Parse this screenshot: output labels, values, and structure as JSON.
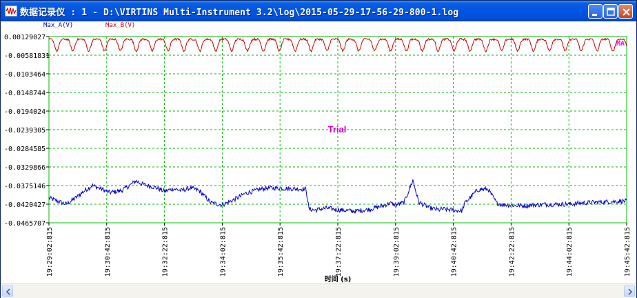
{
  "window": {
    "title": "数据记录仪 : 1 - D:\\VIRTINS Multi-Instrument 3.2\\log\\2015-05-29-17-56-29-800-1.log",
    "icon": "waveform-icon",
    "buttons": [
      "minimize-icon",
      "maximize-icon",
      "close-icon"
    ]
  },
  "colors": {
    "series_a": "#0000cc",
    "series_b": "#cc0000",
    "grid": "#00bb00",
    "watermark": "#cc00cc",
    "marker": "#ff00ff"
  },
  "chart_data": {
    "type": "line",
    "xlabel": "时间 (s)",
    "ylabel": "",
    "legend": [
      "Max_A(V)",
      "Max_B(V)"
    ],
    "legend_placement": "top-left",
    "watermark": "Trial",
    "end_marker": "MA",
    "grid": true,
    "yticks": [
      "0.00129027",
      "-0.00581831",
      "-0.0103464",
      "-0.0148744",
      "-0.0194024",
      "-0.0239305",
      "-0.0284585",
      "-0.0329866",
      "-0.0375146",
      "-0.0420427",
      "-0.0465707"
    ],
    "ylim": [
      -0.0465707,
      0.00129027
    ],
    "xticks": [
      "19:29:02:815",
      "19:30:42:815",
      "19:32:22:815",
      "19:34:02:815",
      "19:35:42:815",
      "19:37:22:815",
      "19:39:02:815",
      "19:40:42:815",
      "19:42:22:815",
      "19:44:02:815",
      "19:45:42:815"
    ],
    "x_range_seconds": [
      0,
      1000
    ],
    "series": [
      {
        "name": "Max_A(V)",
        "color": "#0000cc",
        "x": [
          0,
          30,
          45,
          60,
          75,
          90,
          105,
          125,
          140,
          150,
          165,
          185,
          200,
          215,
          230,
          245,
          260,
          280,
          300,
          310,
          325,
          340,
          355,
          370,
          385,
          400,
          420,
          445,
          450,
          460,
          480,
          500,
          530,
          555,
          580,
          590,
          600,
          615,
          630,
          640,
          660,
          675,
          680,
          700,
          715,
          720,
          740,
          745,
          760,
          775,
          785,
          820,
          860,
          900,
          920,
          990
        ],
        "y": [
          -0.0402,
          -0.0418,
          -0.0403,
          -0.0385,
          -0.037,
          -0.0378,
          -0.0388,
          -0.0383,
          -0.037,
          -0.0358,
          -0.0368,
          -0.0375,
          -0.0385,
          -0.0378,
          -0.0383,
          -0.0376,
          -0.0383,
          -0.0414,
          -0.042,
          -0.0413,
          -0.0403,
          -0.039,
          -0.0384,
          -0.0378,
          -0.0376,
          -0.0377,
          -0.0378,
          -0.0379,
          -0.043,
          -0.0433,
          -0.0428,
          -0.0432,
          -0.0436,
          -0.0431,
          -0.0421,
          -0.0415,
          -0.042,
          -0.0413,
          -0.0356,
          -0.0413,
          -0.0428,
          -0.0433,
          -0.043,
          -0.0433,
          -0.0435,
          -0.0415,
          -0.0384,
          -0.038,
          -0.0379,
          -0.0415,
          -0.0419,
          -0.0422,
          -0.0418,
          -0.0418,
          -0.0415,
          -0.041
        ]
      },
      {
        "name": "Max_B(V)",
        "color": "#cc0000",
        "approx_mean": 0.0005,
        "approx_min": -0.0025,
        "approx_max": 0.0013
      }
    ]
  }
}
